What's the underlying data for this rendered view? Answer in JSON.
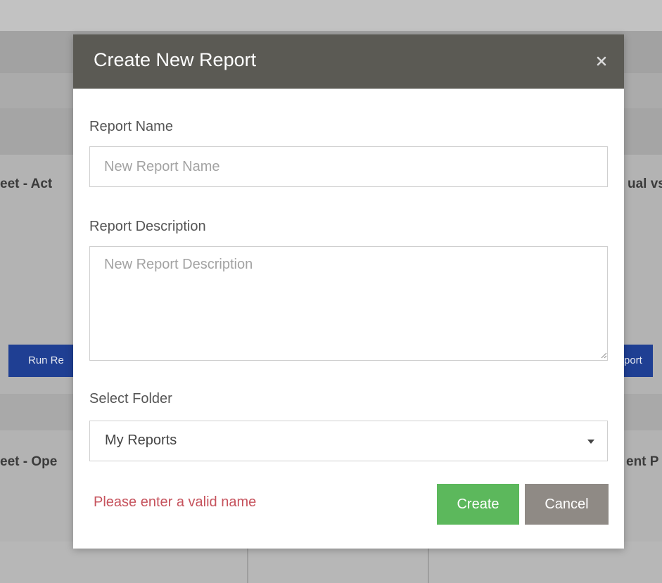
{
  "background": {
    "row1_left_text": "eet - Act",
    "row1_right_text": "ual vs",
    "row2_left_text": "eet - Ope",
    "row2_right_text": "ent P",
    "run_button_left": "Run Re",
    "run_button_right": "port"
  },
  "modal": {
    "title": "Create New Report",
    "close_icon": "close-icon",
    "report_name": {
      "label": "Report Name",
      "placeholder": "New Report Name",
      "value": ""
    },
    "report_description": {
      "label": "Report Description",
      "placeholder": "New Report Description",
      "value": ""
    },
    "folder": {
      "label": "Select Folder",
      "selected": "My Reports",
      "caret_icon": "caret-down-icon"
    },
    "error_message": "Please enter a valid name",
    "buttons": {
      "create": "Create",
      "cancel": "Cancel"
    },
    "colors": {
      "header": "#5b5a54",
      "create": "#5cb85c",
      "cancel": "#8f8a85",
      "error": "#c6535d"
    }
  }
}
